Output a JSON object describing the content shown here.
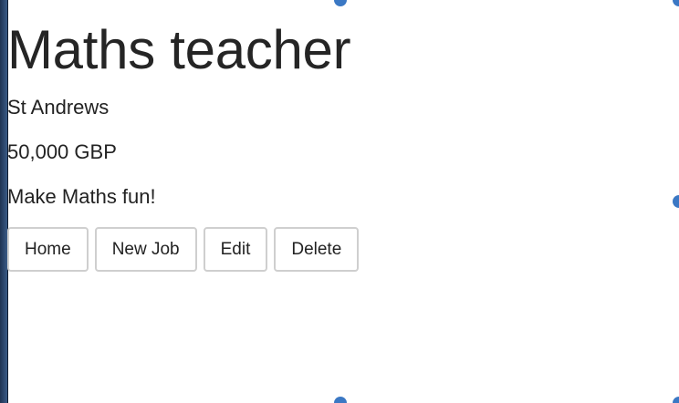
{
  "job": {
    "title": "Maths teacher",
    "location": "St Andrews",
    "salary": "50,000 GBP",
    "description": "Make Maths fun!"
  },
  "actions": {
    "home": "Home",
    "new_job": "New Job",
    "edit": "Edit",
    "delete": "Delete"
  },
  "colors": {
    "handle": "#3b78c4",
    "button_border": "#cfcfcf",
    "text": "#222222"
  }
}
